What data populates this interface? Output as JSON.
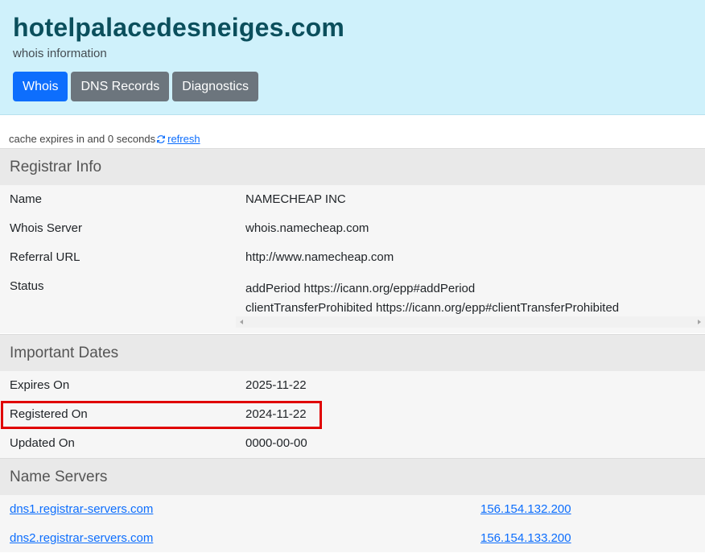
{
  "header": {
    "title": "hotelpalacedesneiges.com",
    "subtitle": "whois information",
    "tabs": [
      {
        "label": "Whois",
        "active": true
      },
      {
        "label": "DNS Records",
        "active": false
      },
      {
        "label": "Diagnostics",
        "active": false
      }
    ]
  },
  "cache": {
    "text": "cache expires in and 0 seconds",
    "refresh_label": " refresh"
  },
  "registrar": {
    "heading": "Registrar Info",
    "name_key": "Name",
    "name_val": "NAMECHEAP INC",
    "server_key": "Whois Server",
    "server_val": "whois.namecheap.com",
    "referral_key": "Referral URL",
    "referral_val": "http://www.namecheap.com",
    "status_key": "Status",
    "status_line1": "addPeriod https://icann.org/epp#addPeriod",
    "status_line2": "clientTransferProhibited https://icann.org/epp#clientTransferProhibited"
  },
  "dates": {
    "heading": "Important Dates",
    "expires_key": "Expires On",
    "expires_val": "2025-11-22",
    "registered_key": "Registered On",
    "registered_val": "2024-11-22",
    "updated_key": "Updated On",
    "updated_val": "0000-00-00"
  },
  "nameservers": {
    "heading": "Name Servers",
    "ns1_host": "dns1.registrar-servers.com",
    "ns1_ip": "156.154.132.200",
    "ns2_host": "dns2.registrar-servers.com",
    "ns2_ip": "156.154.133.200"
  },
  "colors": {
    "header_bg": "#cff1fb",
    "active_tab": "#0d6efd",
    "inactive_tab": "#6c757d",
    "highlight": "#e00000"
  }
}
